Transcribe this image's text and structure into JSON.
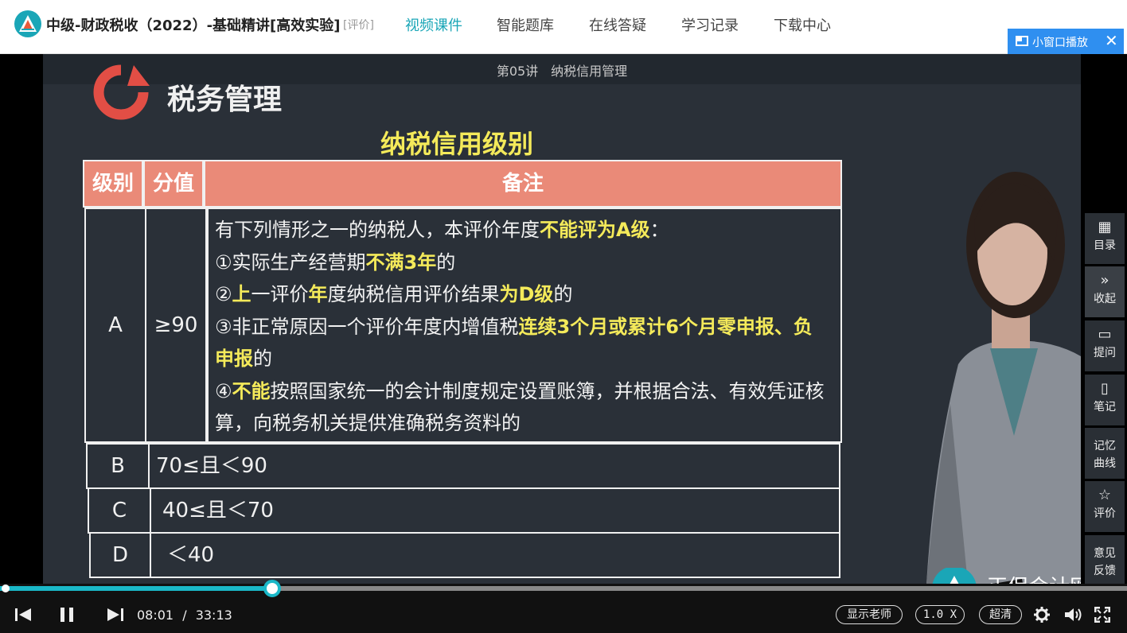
{
  "header": {
    "course_title": "中级-财政税收（2022）-基础精讲[高效实验]",
    "rate_link": "[评价]",
    "nav": [
      {
        "label": "视频课件",
        "active": true
      },
      {
        "label": "智能题库",
        "active": false
      },
      {
        "label": "在线答疑",
        "active": false
      },
      {
        "label": "学习记录",
        "active": false
      },
      {
        "label": "下载中心",
        "active": false
      }
    ],
    "mini_window": {
      "label": "小窗口播放",
      "close": "✕"
    }
  },
  "slide": {
    "lecture_title": "第05讲　纳税信用管理",
    "brand_text": "税务管理",
    "heading": "纳税信用级别",
    "table": {
      "headers": [
        "级别",
        "分值",
        "备注"
      ],
      "rowA": {
        "grade": "A",
        "score": "≥90",
        "remark": [
          {
            "t": "有下列情形之一的纳税人，本评价年度",
            "hl": false
          },
          {
            "t": "不能评为A级",
            "hl": true
          },
          {
            "t": "：",
            "hl": false
          },
          {
            "t": "①实际生产经营期",
            "hl": false
          },
          {
            "t": "不满3年",
            "hl": true
          },
          {
            "t": "的",
            "hl": false
          },
          {
            "t": "②",
            "hl": false
          },
          {
            "t": "上",
            "hl": true
          },
          {
            "t": "一评价",
            "hl": false
          },
          {
            "t": "年",
            "hl": true
          },
          {
            "t": "度纳税信用评价结果",
            "hl": false
          },
          {
            "t": "为D级",
            "hl": true
          },
          {
            "t": "的",
            "hl": false
          },
          {
            "t": "③非正常原因一个评价年度内增值税",
            "hl": false
          },
          {
            "t": "连续3个月或累计6个月零申报、负申报",
            "hl": true
          },
          {
            "t": "的",
            "hl": false
          },
          {
            "t": "④",
            "hl": false
          },
          {
            "t": "不能",
            "hl": true
          },
          {
            "t": "按照国家统一的会计制度规定设置账簿，并根据合法、有效凭证核算，向税务机关提供准确税务资料的",
            "hl": false
          }
        ]
      },
      "rows": [
        {
          "grade": "B",
          "score": "70≤且＜90"
        },
        {
          "grade": "C",
          "score": "40≤且＜70"
        },
        {
          "grade": "D",
          "score": "＜40"
        }
      ]
    },
    "watermark_text": "正保会计网校"
  },
  "side_panel": [
    {
      "icon": "grid-icon",
      "label": "目录"
    },
    {
      "icon": "chevron-double-right-icon",
      "label": "收起"
    },
    {
      "icon": "comment-icon",
      "label": "提问"
    },
    {
      "icon": "note-icon",
      "label": "笔记"
    },
    {
      "icon": "",
      "label": "记忆曲线"
    },
    {
      "icon": "star-icon",
      "label": "评价"
    },
    {
      "icon": "",
      "label": "意见反馈"
    }
  ],
  "player": {
    "current_time": "08:01",
    "separator": "/",
    "duration": "33:13",
    "progress_fraction": 0.2413,
    "show_teacher": "显示老师",
    "speed": "1.0 X",
    "quality": "超清"
  },
  "colors": {
    "accent": "#1aa6b7",
    "progress": "#1ab8c8",
    "header_row": "#ea8a78",
    "highlight": "#f4ea5a",
    "mini_window": "#2f8ff0"
  }
}
